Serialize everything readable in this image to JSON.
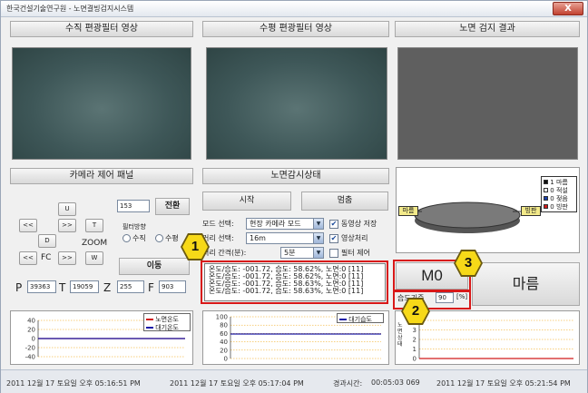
{
  "window": {
    "title": "한국건설기술연구원 - 노면결빙검지시스템",
    "close_label": "X"
  },
  "video_panels": {
    "vertical_label": "수직 편광필터 영상",
    "horizontal_label": "수평 편광필터 영상",
    "result_label": "노면 검지 결과"
  },
  "camera_panel": {
    "title": "카메라 제어 패널",
    "up_label": "U",
    "down_label": "D",
    "left_left_label": "<<",
    "right_right_label": ">>",
    "left_fc_label": "<<",
    "right_fc_label": ">>",
    "t_label": "T",
    "w_label": "W",
    "fc_label": "FC",
    "zoom_label": "ZOOM",
    "input_value": "153",
    "switch_label": "전환",
    "filter_direction_label": "필터방향",
    "vertical_radio_label": "수직",
    "horizontal_radio_label": "수평",
    "move_label": "이동",
    "p_label": "P",
    "p_value": "39363",
    "t_pos_label": "T",
    "t_value": "19059",
    "z_label": "Z",
    "z_value": "255",
    "f_label": "F",
    "f_value": "903"
  },
  "status_panel": {
    "title": "노면감시상태",
    "start_label": "시작",
    "stop_label": "멈춤",
    "mode_label": "모드 선택:",
    "mode_value": "현장 카메라 모드",
    "distance_label": "거리 선택:",
    "distance_value": "16m",
    "interval_label": "처리 간격(분):",
    "interval_value": "5분",
    "save_video_label": "동영상 저장",
    "process_video_label": "영상처리",
    "filter_control_label": "필터 제어",
    "save_video_checked": true,
    "process_video_checked": true,
    "filter_control_checked": false
  },
  "log": {
    "lines": [
      "온도/습도: -001.72, 습도: 58.62%, 노면:0 [11]",
      "온도/습도: -001.72, 습도: 58.62%, 노면:0 [11]",
      "온도/습도: -001.72, 습도: 58.63%, 노면:0 [11]",
      "온도/습도: -001.72, 습도: 58.63%, 노면:0 [11]"
    ]
  },
  "result": {
    "code": "M0",
    "state_label": "마름",
    "humidity_label": "습도기준",
    "humidity_value": "90",
    "humidity_unit": "[%]"
  },
  "pie": {
    "left_tag": "마름",
    "right_tag": "빙판",
    "legend": [
      {
        "count": "1",
        "label": "마름",
        "color": "#111111"
      },
      {
        "count": "0",
        "label": "적설",
        "color": "#ffffff"
      },
      {
        "count": "0",
        "label": "젖음",
        "color": "#1a3fa8"
      },
      {
        "count": "0",
        "label": "빙판",
        "color": "#d01a1a"
      }
    ]
  },
  "chart_data": [
    {
      "type": "line",
      "legend": [
        "노면온도",
        "대기온도"
      ],
      "ylim": [
        -40,
        40
      ],
      "ticks": [
        "40",
        "20",
        "0",
        "-20",
        "-40"
      ],
      "series": [
        {
          "name": "노면온도",
          "values": [
            0,
            0,
            0,
            0,
            0
          ],
          "color": "#d01a1a"
        },
        {
          "name": "대기온도",
          "values": [
            0,
            0,
            0,
            0,
            0
          ],
          "color": "#1a1aa8"
        }
      ]
    },
    {
      "type": "line",
      "legend": [
        "대기습도"
      ],
      "ylim": [
        0,
        100
      ],
      "ticks": [
        "100",
        "80",
        "60",
        "40",
        "20",
        "0"
      ],
      "series": [
        {
          "name": "대기습도",
          "values": [
            58.6,
            58.6,
            58.6,
            58.6,
            58.6
          ],
          "color": "#1a1aa8"
        }
      ]
    },
    {
      "type": "line",
      "ylabel": "노면상태",
      "ticks": [
        "4",
        "3",
        "2",
        "1",
        "0"
      ],
      "ylim": [
        0,
        4
      ],
      "series": [
        {
          "name": "노면상태",
          "values": [
            0,
            0,
            0,
            0,
            0
          ],
          "color": "#d01a1a"
        }
      ]
    }
  ],
  "statusbar": {
    "time1": "2011 12월 17 토요일 오후 05:16:51 PM",
    "time2": "2011 12월 17 토요일 오후 05:17:04 PM",
    "elapsed_label": "경과시간:",
    "elapsed": "00:05:03 069",
    "time3": "2011 12월 17 토요일 오후 05:21:54 PM"
  },
  "annotations": {
    "one": "1",
    "two": "2",
    "three": "3"
  },
  "colors": {
    "annotation_red": "#d81818",
    "badge_yellow": "#f7d918"
  }
}
